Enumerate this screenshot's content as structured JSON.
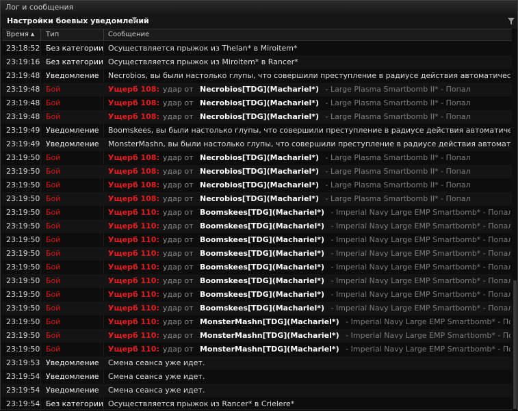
{
  "window": {
    "title": "Лог и сообщения"
  },
  "settings": {
    "label": "Настройки боевых уведомлений",
    "filter_icon": "filter-icon"
  },
  "columns": {
    "time": "Время",
    "type": "Тип",
    "message": "Сообщение"
  },
  "colors": {
    "combat": "#e01818",
    "damage": "#e81c1c",
    "attacker": "#ffffff",
    "weapon": "#7c7c7c"
  },
  "rows": [
    {
      "time": "23:18:52",
      "type": "Без категории",
      "kind": "text",
      "text": "Осуществляется прыжок из Thelan* в Miroitem*"
    },
    {
      "time": "23:19:16",
      "type": "Без категории",
      "kind": "text",
      "text": "Осуществляется прыжок из Miroitem* в Rancer*"
    },
    {
      "time": "23:19:48",
      "type": "Уведомление",
      "kind": "text",
      "text": "Necrobios, вы были настолько глупы, что совершили преступление в радиусе действия автоматических оруди"
    },
    {
      "time": "23:19:48",
      "type": "Бой",
      "kind": "combat",
      "damage": "Ущерб 108:",
      "hit": "удар от",
      "attacker": "Necrobios[TDG](Machariel*)",
      "weapon": "- Large Plasma Smartbomb II* - Попал"
    },
    {
      "time": "23:19:48",
      "type": "Бой",
      "kind": "combat",
      "damage": "Ущерб 108:",
      "hit": "удар от",
      "attacker": "Necrobios[TDG](Machariel*)",
      "weapon": "- Large Plasma Smartbomb II* - Попал"
    },
    {
      "time": "23:19:48",
      "type": "Бой",
      "kind": "combat",
      "damage": "Ущерб 108:",
      "hit": "удар от",
      "attacker": "Necrobios[TDG](Machariel*)",
      "weapon": "- Large Plasma Smartbomb II* - Попал"
    },
    {
      "time": "23:19:49",
      "type": "Уведомление",
      "kind": "text",
      "text": "Boomskees, вы были настолько глупы, что совершили преступление в радиусе действия автоматических ору"
    },
    {
      "time": "23:19:49",
      "type": "Уведомление",
      "kind": "text",
      "text": "MonsterMashn, вы были настолько глупы, что совершили преступление в радиусе действия автоматических о"
    },
    {
      "time": "23:19:50",
      "type": "Бой",
      "kind": "combat",
      "damage": "Ущерб 108:",
      "hit": "удар от",
      "attacker": "Necrobios[TDG](Machariel*)",
      "weapon": "- Large Plasma Smartbomb II* - Попал"
    },
    {
      "time": "23:19:50",
      "type": "Бой",
      "kind": "combat",
      "damage": "Ущерб 108:",
      "hit": "удар от",
      "attacker": "Necrobios[TDG](Machariel*)",
      "weapon": "- Large Plasma Smartbomb II* - Попал"
    },
    {
      "time": "23:19:50",
      "type": "Бой",
      "kind": "combat",
      "damage": "Ущерб 108:",
      "hit": "удар от",
      "attacker": "Necrobios[TDG](Machariel*)",
      "weapon": "- Large Plasma Smartbomb II* - Попал"
    },
    {
      "time": "23:19:50",
      "type": "Бой",
      "kind": "combat",
      "damage": "Ущерб 108:",
      "hit": "удар от",
      "attacker": "Necrobios[TDG](Machariel*)",
      "weapon": "- Large Plasma Smartbomb II* - Попал"
    },
    {
      "time": "23:19:50",
      "type": "Бой",
      "kind": "combat",
      "damage": "Ущерб 110:",
      "hit": "удар от",
      "attacker": "Boomskees[TDG](Machariel*)",
      "weapon": "- Imperial Navy Large EMP Smartbomb* - Попал"
    },
    {
      "time": "23:19:50",
      "type": "Бой",
      "kind": "combat",
      "damage": "Ущерб 110:",
      "hit": "удар от",
      "attacker": "Boomskees[TDG](Machariel*)",
      "weapon": "- Imperial Navy Large EMP Smartbomb* - Попал"
    },
    {
      "time": "23:19:50",
      "type": "Бой",
      "kind": "combat",
      "damage": "Ущерб 110:",
      "hit": "удар от",
      "attacker": "Boomskees[TDG](Machariel*)",
      "weapon": "- Imperial Navy Large EMP Smartbomb* - Попал"
    },
    {
      "time": "23:19:50",
      "type": "Бой",
      "kind": "combat",
      "damage": "Ущерб 110:",
      "hit": "удар от",
      "attacker": "Boomskees[TDG](Machariel*)",
      "weapon": "- Imperial Navy Large EMP Smartbomb* - Попал"
    },
    {
      "time": "23:19:50",
      "type": "Бой",
      "kind": "combat",
      "damage": "Ущерб 110:",
      "hit": "удар от",
      "attacker": "Boomskees[TDG](Machariel*)",
      "weapon": "- Imperial Navy Large EMP Smartbomb* - Попал"
    },
    {
      "time": "23:19:50",
      "type": "Бой",
      "kind": "combat",
      "damage": "Ущерб 110:",
      "hit": "удар от",
      "attacker": "Boomskees[TDG](Machariel*)",
      "weapon": "- Imperial Navy Large EMP Smartbomb* - Попал"
    },
    {
      "time": "23:19:50",
      "type": "Бой",
      "kind": "combat",
      "damage": "Ущерб 110:",
      "hit": "удар от",
      "attacker": "Boomskees[TDG](Machariel*)",
      "weapon": "- Imperial Navy Large EMP Smartbomb* - Попал"
    },
    {
      "time": "23:19:50",
      "type": "Бой",
      "kind": "combat",
      "damage": "Ущерб 110:",
      "hit": "удар от",
      "attacker": "Boomskees[TDG](Machariel*)",
      "weapon": "- Imperial Navy Large EMP Smartbomb* - Попал"
    },
    {
      "time": "23:19:50",
      "type": "Бой",
      "kind": "combat",
      "damage": "Ущерб 110:",
      "hit": "удар от",
      "attacker": "MonsterMashn[TDG](Machariel*)",
      "weapon": "- Imperial Navy Large EMP Smartbomb* - Попал"
    },
    {
      "time": "23:19:50",
      "type": "Бой",
      "kind": "combat",
      "damage": "Ущерб 110:",
      "hit": "удар от",
      "attacker": "MonsterMashn[TDG](Machariel*)",
      "weapon": "- Imperial Navy Large EMP Smartbomb* - Попал"
    },
    {
      "time": "23:19:50",
      "type": "Бой",
      "kind": "combat",
      "damage": "Ущерб 110:",
      "hit": "удар от",
      "attacker": "MonsterMashn[TDG](Machariel*)",
      "weapon": "- Imperial Navy Large EMP Smartbomb* - Попал"
    },
    {
      "time": "23:19:53",
      "type": "Уведомление",
      "kind": "text",
      "text": "Смена сеанса уже идет."
    },
    {
      "time": "23:19:54",
      "type": "Уведомление",
      "kind": "text",
      "text": "Смена сеанса уже идет."
    },
    {
      "time": "23:19:54",
      "type": "Уведомление",
      "kind": "text",
      "text": "Смена сеанса уже идет."
    },
    {
      "time": "23:19:54",
      "type": "Без категории",
      "kind": "text",
      "text": "Осуществляется прыжок из Rancer* в Crielere*"
    }
  ]
}
